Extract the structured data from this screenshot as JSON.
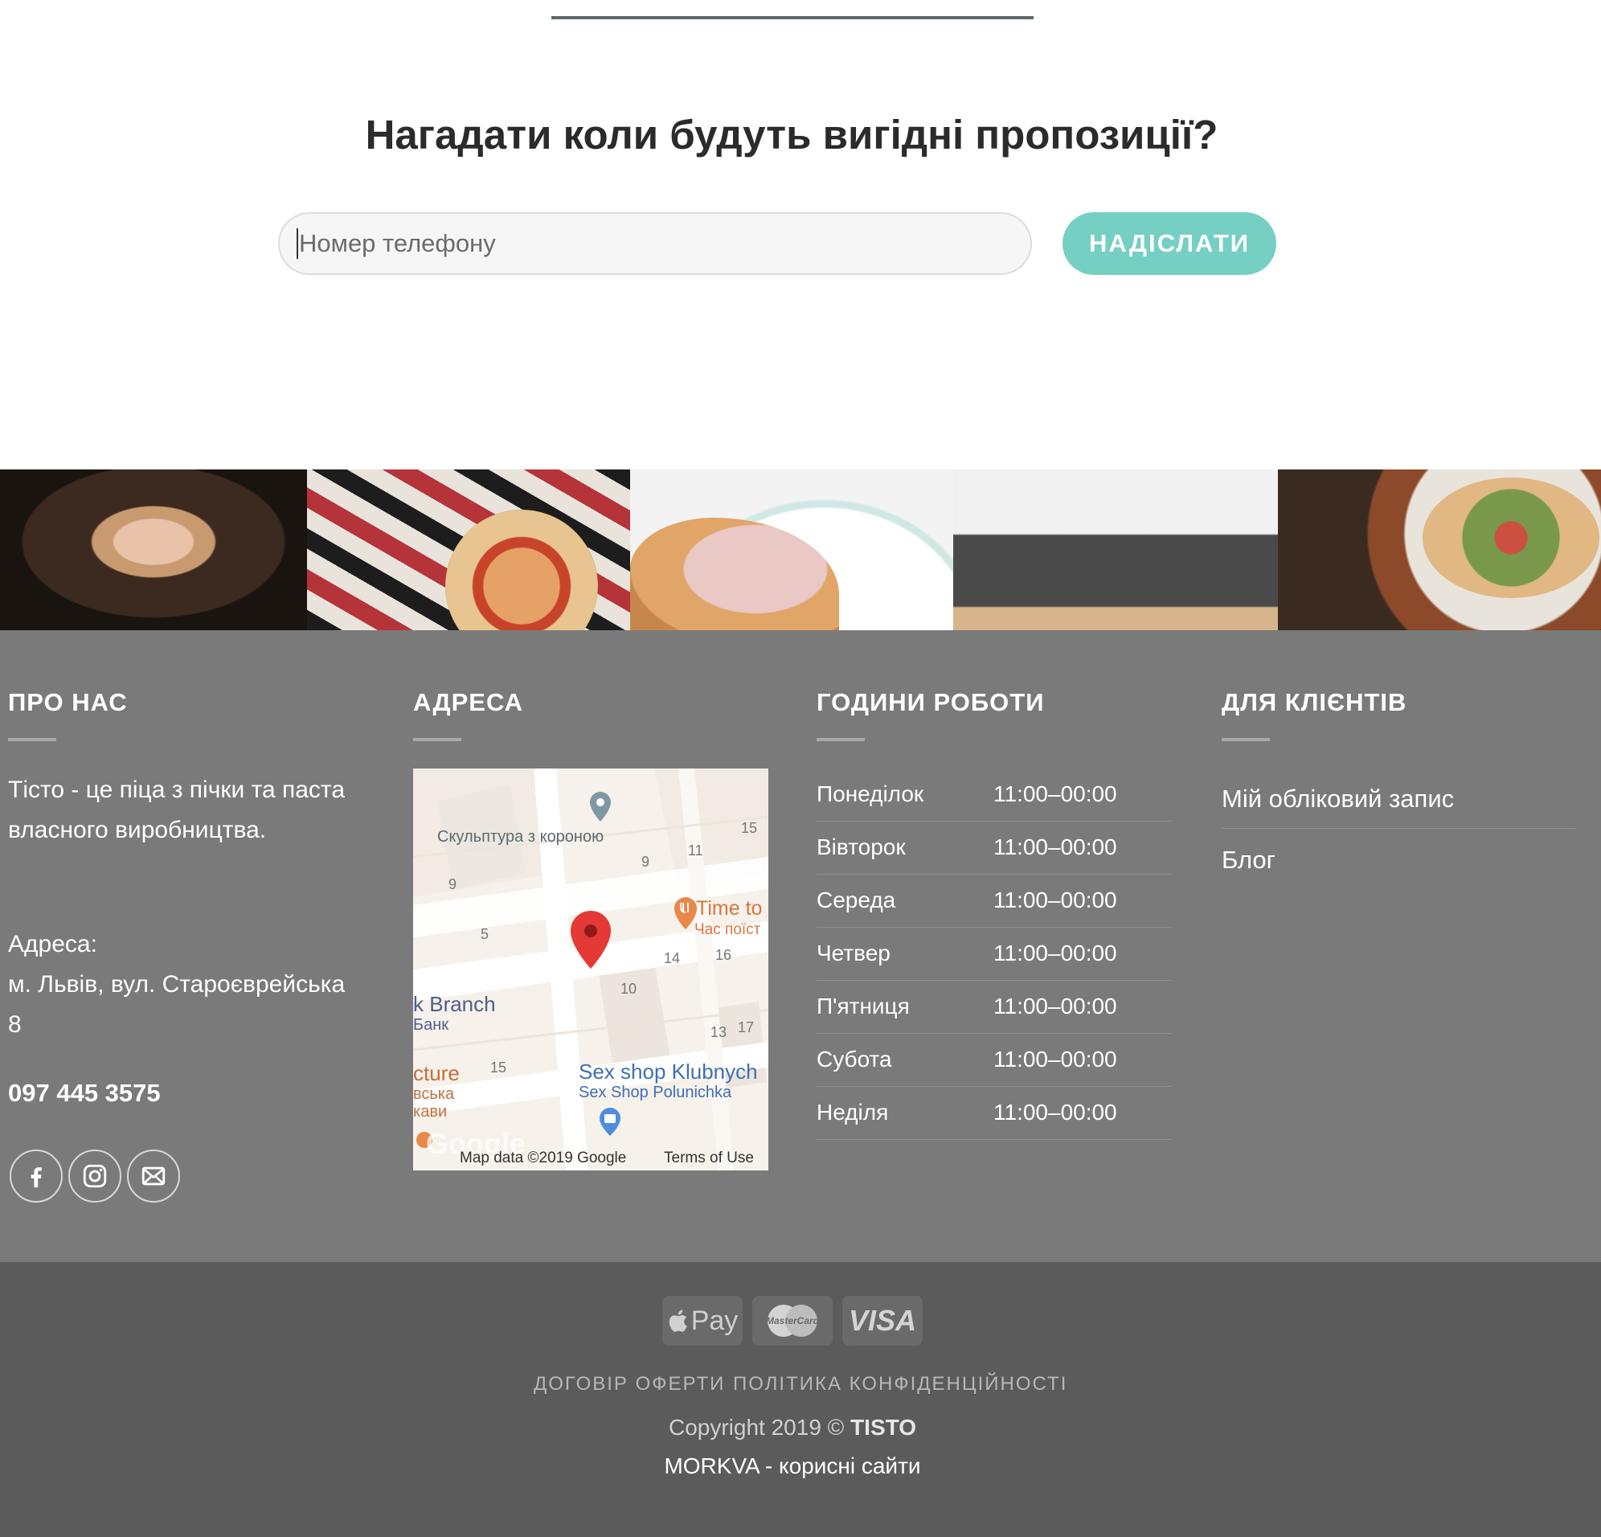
{
  "subscribe": {
    "headline": "Нагадати коли будуть вигідні пропозиції?",
    "phone_placeholder": "Номер телефону",
    "send_label": "НАДІСЛАТИ"
  },
  "footer": {
    "about": {
      "title": "ПРО НАС",
      "text": "Тісто - це піца з пічки та паста власного виробництва.",
      "address_label": "Адреса:",
      "address": "м. Львів, вул. Староєврейська 8",
      "phone": "097 445 3575"
    },
    "address": {
      "title": "АДРЕСА",
      "map": {
        "labels": {
          "sculpture": "Скульптура з короною",
          "time_to": "Time to",
          "chas": "Час поїст",
          "branch": "k Branch",
          "bank": "Банк",
          "cture": "cture",
          "vska": "вська",
          "kavy": "кави",
          "sex_shop": "Sex shop Klubnych",
          "sex_shop_sub": "Sex Shop Polunichka",
          "n15a": "15",
          "n11": "11",
          "n9a": "9",
          "n9b": "9",
          "n5": "5",
          "n14": "14",
          "n16": "16",
          "n10": "10",
          "n13": "13",
          "n17": "17",
          "n15b": "15"
        },
        "attribution": "Map data ©2019 Google",
        "terms": "Terms of Use",
        "google": "Google"
      }
    },
    "hours": {
      "title": "ГОДИНИ РОБОТИ",
      "rows": [
        {
          "day": "Понеділок",
          "time": "11:00–00:00"
        },
        {
          "day": "Вівторок",
          "time": "11:00–00:00"
        },
        {
          "day": "Середа",
          "time": "11:00–00:00"
        },
        {
          "day": "Четвер",
          "time": "11:00–00:00"
        },
        {
          "day": "П'ятниця",
          "time": "11:00–00:00"
        },
        {
          "day": "Субота",
          "time": "11:00–00:00"
        },
        {
          "day": "Неділя",
          "time": "11:00–00:00"
        }
      ]
    },
    "clients": {
      "title": "ДЛЯ КЛІЄНТІВ",
      "links": [
        "Мій обліковий запис",
        "Блог"
      ]
    },
    "social_icons": [
      "facebook-icon",
      "instagram-icon",
      "email-icon"
    ]
  },
  "bottom": {
    "payments": [
      "Pay",
      "MasterCard",
      "VISA"
    ],
    "legal": [
      "ДОГОВІР ОФЕРТИ",
      "ПОЛІТИКА КОНФІДЕНЦІЙНОСТІ"
    ],
    "copyright_prefix": "Copyright 2019 ©",
    "copyright_brand": "TISTO",
    "dev_line": "MORKVA - корисні сайти"
  },
  "colors": {
    "accent": "#76cfc3",
    "footer_main": "#7a7a7a",
    "footer_bottom": "#5b5b5b",
    "map_pin": "#e53935"
  }
}
